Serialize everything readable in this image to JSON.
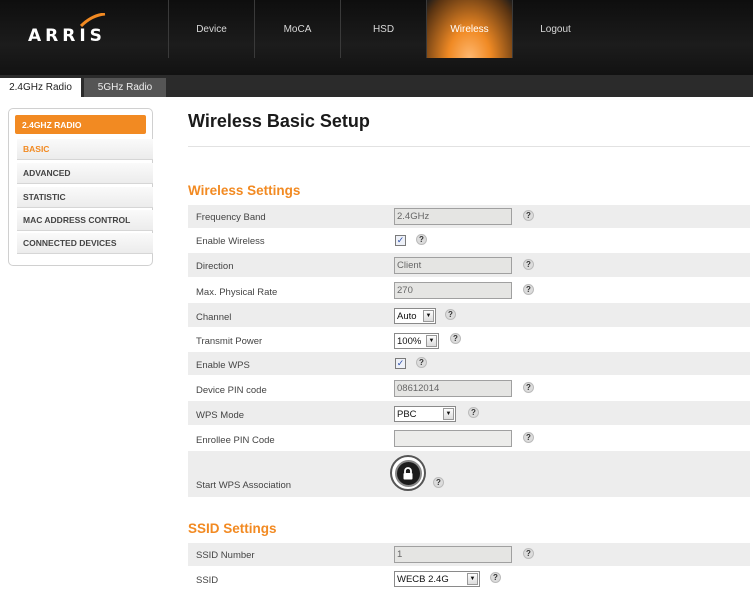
{
  "header": {
    "logo_text": "ARRIS",
    "nav": [
      {
        "label": "Device"
      },
      {
        "label": "MoCA"
      },
      {
        "label": "HSD"
      },
      {
        "label": "Wireless",
        "active": true
      },
      {
        "label": "Logout"
      }
    ]
  },
  "tabs": [
    {
      "label": "2.4GHz Radio",
      "active": true
    },
    {
      "label": "5GHz Radio"
    }
  ],
  "sidebar": {
    "heading": "2.4GHZ RADIO",
    "items": [
      {
        "label": "BASIC",
        "active": true
      },
      {
        "label": "ADVANCED"
      },
      {
        "label": "STATISTIC"
      },
      {
        "label": "MAC ADDRESS CONTROL"
      },
      {
        "label": "CONNECTED DEVICES"
      }
    ]
  },
  "main": {
    "title": "Wireless Basic Setup",
    "wireless_settings": {
      "heading": "Wireless Settings",
      "frequency_band": {
        "label": "Frequency Band",
        "value": "2.4GHz"
      },
      "enable_wireless": {
        "label": "Enable Wireless",
        "checked": true
      },
      "direction": {
        "label": "Direction",
        "value": "Client"
      },
      "max_rate": {
        "label": "Max. Physical Rate",
        "value": "270"
      },
      "channel": {
        "label": "Channel",
        "value": "Auto"
      },
      "transmit_power": {
        "label": "Transmit Power",
        "value": "100%"
      },
      "enable_wps": {
        "label": "Enable WPS",
        "checked": true
      },
      "device_pin": {
        "label": "Device PIN code",
        "value": "08612014"
      },
      "wps_mode": {
        "label": "WPS Mode",
        "value": "PBC"
      },
      "enrollee_pin": {
        "label": "Enrollee PIN Code",
        "value": ""
      },
      "start_wps": {
        "label": "Start WPS Association"
      }
    },
    "ssid_settings": {
      "heading": "SSID Settings",
      "ssid_number": {
        "label": "SSID Number",
        "value": "1"
      },
      "ssid": {
        "label": "SSID",
        "value": "WECB 2.4G"
      }
    },
    "help_glyph": "?",
    "check_glyph": "✓",
    "dropdown_glyph": "▼"
  },
  "colors": {
    "accent": "#f28a22",
    "header_bg": "#141414",
    "row_shade": "#ededed"
  }
}
